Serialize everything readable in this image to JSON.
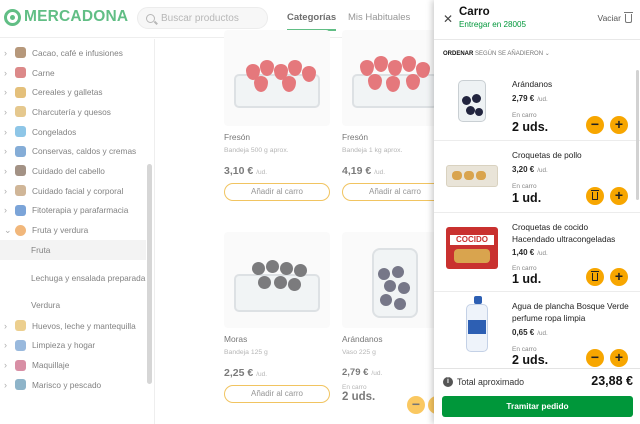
{
  "header": {
    "logo_text": "MERCADONA",
    "search_placeholder": "Buscar productos",
    "tabs": [
      "Categorías",
      "Mis Habituales"
    ]
  },
  "sidebar": {
    "categories": [
      {
        "label": "Cacao, café e infusiones",
        "icon": "coffee-icon",
        "color": "#8a5a2b"
      },
      {
        "label": "Carne",
        "icon": "meat-icon",
        "color": "#c74242"
      },
      {
        "label": "Cereales y galletas",
        "icon": "cereal-icon",
        "color": "#d49a2a"
      },
      {
        "label": "Charcutería y quesos",
        "icon": "cheese-icon",
        "color": "#d5a64a"
      },
      {
        "label": "Congelados",
        "icon": "snowflake-icon",
        "color": "#4aa3d8"
      },
      {
        "label": "Conservas, caldos y cremas",
        "icon": "can-icon",
        "color": "#3a7bbf"
      },
      {
        "label": "Cuidado del cabello",
        "icon": "shampoo-icon",
        "color": "#6b4f3a"
      },
      {
        "label": "Cuidado facial y corporal",
        "icon": "lotion-icon",
        "color": "#b48a5a"
      },
      {
        "label": "Fitoterapia y parafarmacia",
        "icon": "cross-icon",
        "color": "#2b6cc1"
      },
      {
        "label": "Fruta y verdura",
        "icon": "orange-icon",
        "color": "#e88b2a"
      }
    ],
    "subcategories": [
      "Fruta",
      "Lechuga y ensalada preparada",
      "Verdura"
    ],
    "categories_after": [
      {
        "label": "Huevos, leche y mantequilla",
        "icon": "egg-icon",
        "color": "#e0b24b"
      },
      {
        "label": "Limpieza y hogar",
        "icon": "cleaning-icon",
        "color": "#5b8ec9"
      },
      {
        "label": "Maquillaje",
        "icon": "lipstick-icon",
        "color": "#c14b6e"
      },
      {
        "label": "Marisco y pescado",
        "icon": "fish-icon",
        "color": "#4a86a8"
      }
    ]
  },
  "products": [
    {
      "name": "Fresón",
      "size": "Bandeja 500 g aprox.",
      "price": "3,10 €",
      "unit": "/ud.",
      "button": "Añadir al carro"
    },
    {
      "name": "Fresón",
      "size": "Bandeja 1 kg aprox.",
      "price": "4,19 €",
      "unit": "/ud.",
      "button": "Añadir al carro"
    },
    {
      "name": "Moras",
      "size": "Bandeja 125 g",
      "price": "2,25 €",
      "unit": "/ud.",
      "button": "Añadir al carro"
    },
    {
      "name": "Arándanos",
      "size": "Vaso 225 g",
      "price": "2,79 €",
      "unit": "/ud.",
      "in_cart_label": "En carro",
      "in_cart_qty": "2 uds."
    }
  ],
  "cart": {
    "title": "Carro",
    "subtitle": "Entregar en 28005",
    "clear_label": "Vaciar",
    "order_label": "ORDENAR",
    "order_value": "SEGÚN SE AÑADIERON",
    "items": [
      {
        "name": "Arándanos",
        "price": "2,79 €",
        "unit": "/ud.",
        "in_cart_label": "En carro",
        "qty": "2 uds."
      },
      {
        "name": "Croquetas de pollo",
        "price": "3,20 €",
        "unit": "/ud.",
        "in_cart_label": "En carro",
        "qty": "1 ud."
      },
      {
        "name": "Croquetas de cocido Hacendado ultracongeladas",
        "price": "1,40 €",
        "unit": "/ud.",
        "in_cart_label": "En carro",
        "qty": "1 ud.",
        "package_text": "COCIDO"
      },
      {
        "name": "Agua de plancha Bosque Verde perfume ropa limpia",
        "price": "0,65 €",
        "unit": "/ud.",
        "in_cart_label": "En carro",
        "qty": "2 uds."
      }
    ],
    "total_label": "Total aproximado",
    "total_value": "23,88 €",
    "checkout_label": "Tramitar pedido",
    "accent_color": "#00973a",
    "button_color": "#f7a600"
  }
}
